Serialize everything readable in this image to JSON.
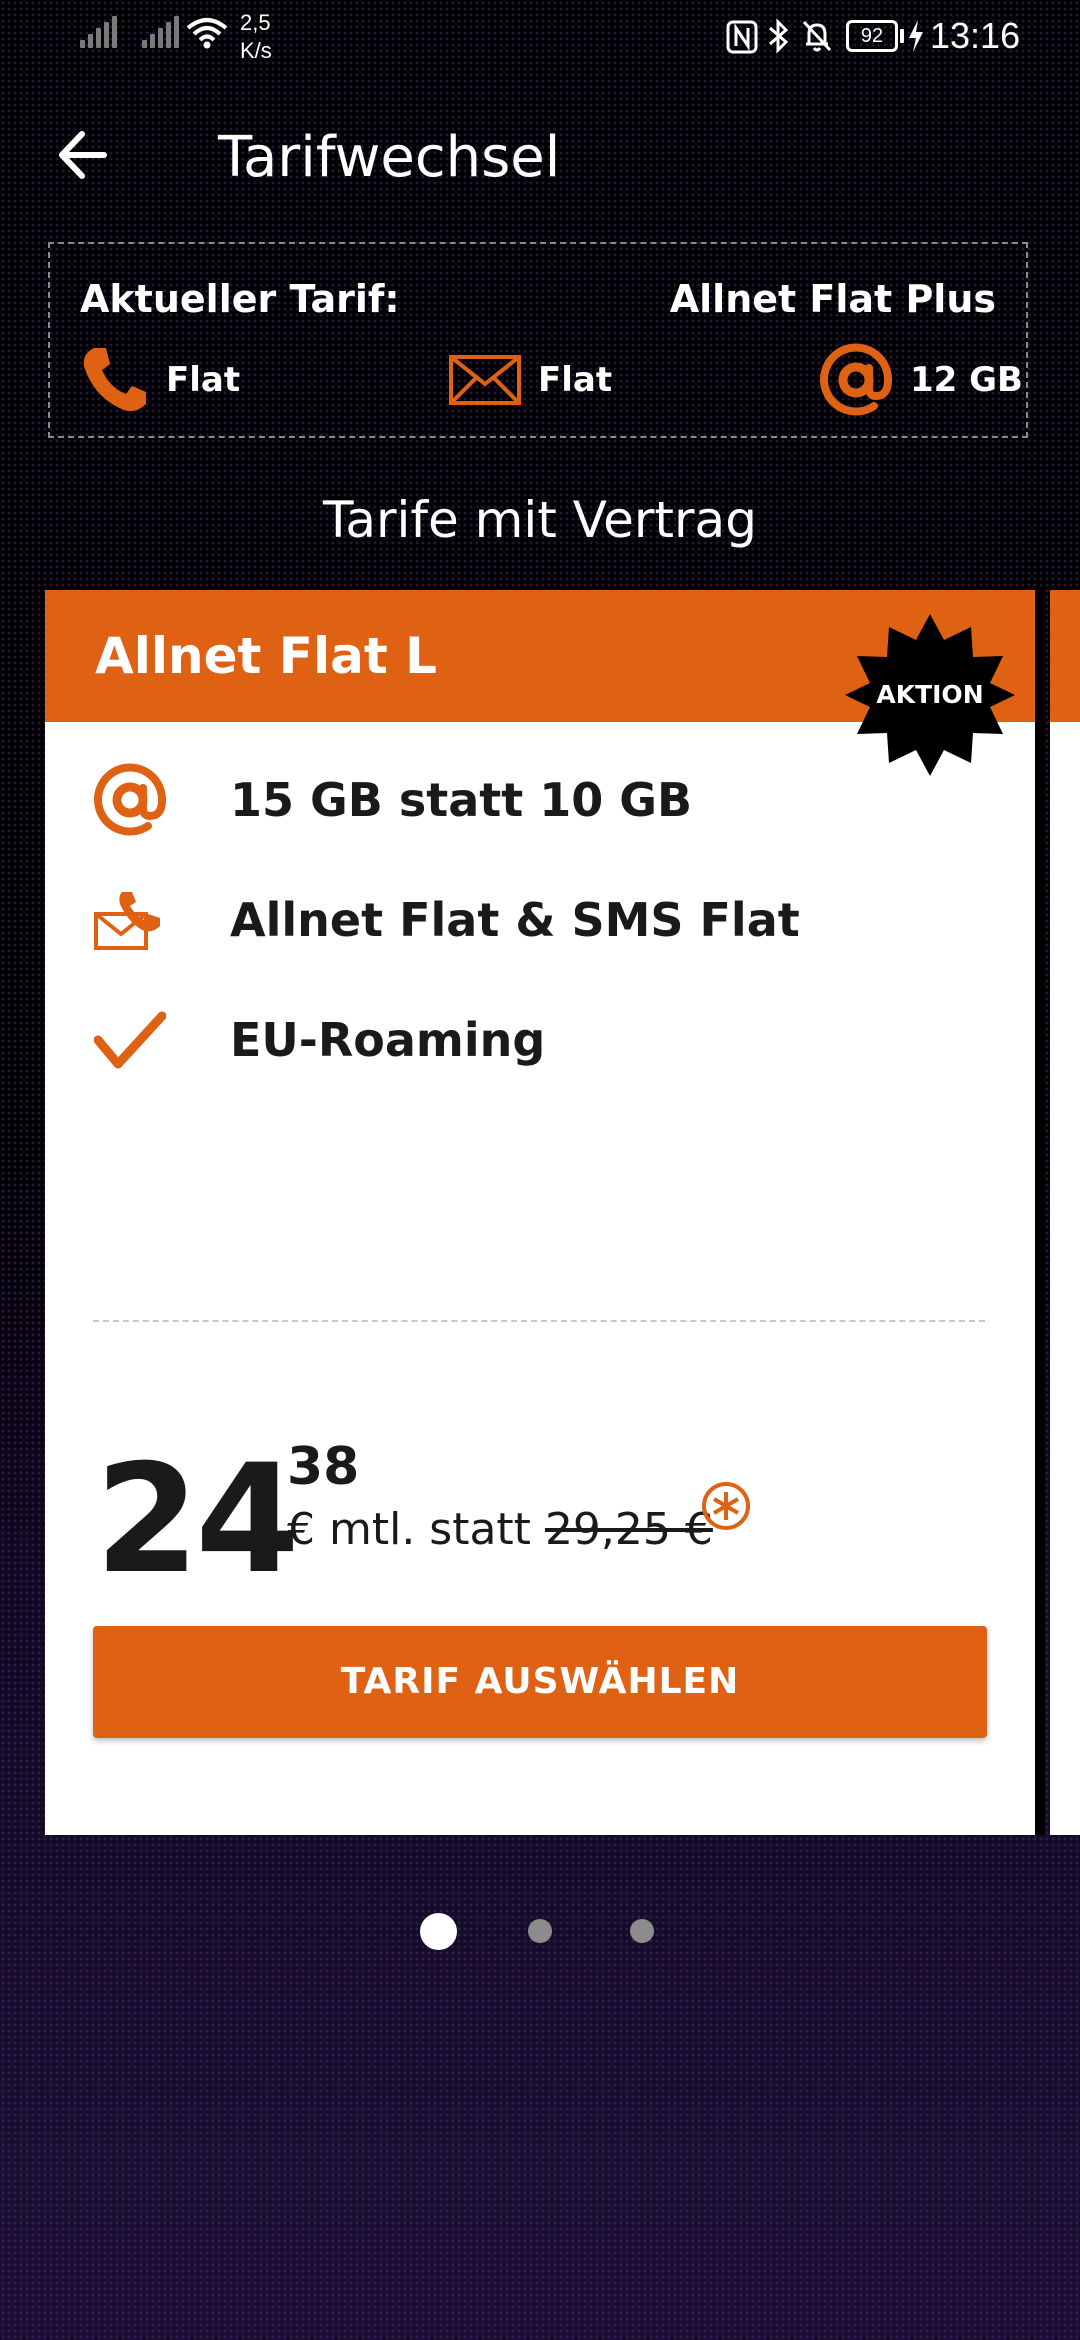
{
  "status_bar": {
    "speed_value": "2,5",
    "speed_unit": "K/s",
    "battery": "92",
    "time": "13:16"
  },
  "header": {
    "title": "Tarifwechsel"
  },
  "current_tariff": {
    "label": "Aktueller Tarif:",
    "name": "Allnet Flat Plus",
    "features": [
      {
        "icon": "phone-icon",
        "value": "Flat"
      },
      {
        "icon": "envelope-icon",
        "value": "Flat"
      },
      {
        "icon": "at-icon",
        "value": "12 GB"
      }
    ]
  },
  "section_title": "Tarife mit Vertrag",
  "card": {
    "title": "Allnet Flat L",
    "badge": "AKTION",
    "benefits": [
      {
        "icon": "at-icon",
        "text": "15 GB statt 10 GB"
      },
      {
        "icon": "mail-phone-icon",
        "text": "Allnet Flat & SMS Flat"
      },
      {
        "icon": "checkmark-icon",
        "text": "EU-Roaming"
      }
    ],
    "price": {
      "euros": "24",
      "cents": "38",
      "suffix": "€ mtl. statt",
      "old_price": "29,25 €"
    },
    "button_label": "TARIF AUSWÄHLEN"
  },
  "pager": {
    "total": 3,
    "active_index": 0
  },
  "colors": {
    "accent": "#de6114",
    "background": "#000000",
    "card": "#ffffff"
  }
}
